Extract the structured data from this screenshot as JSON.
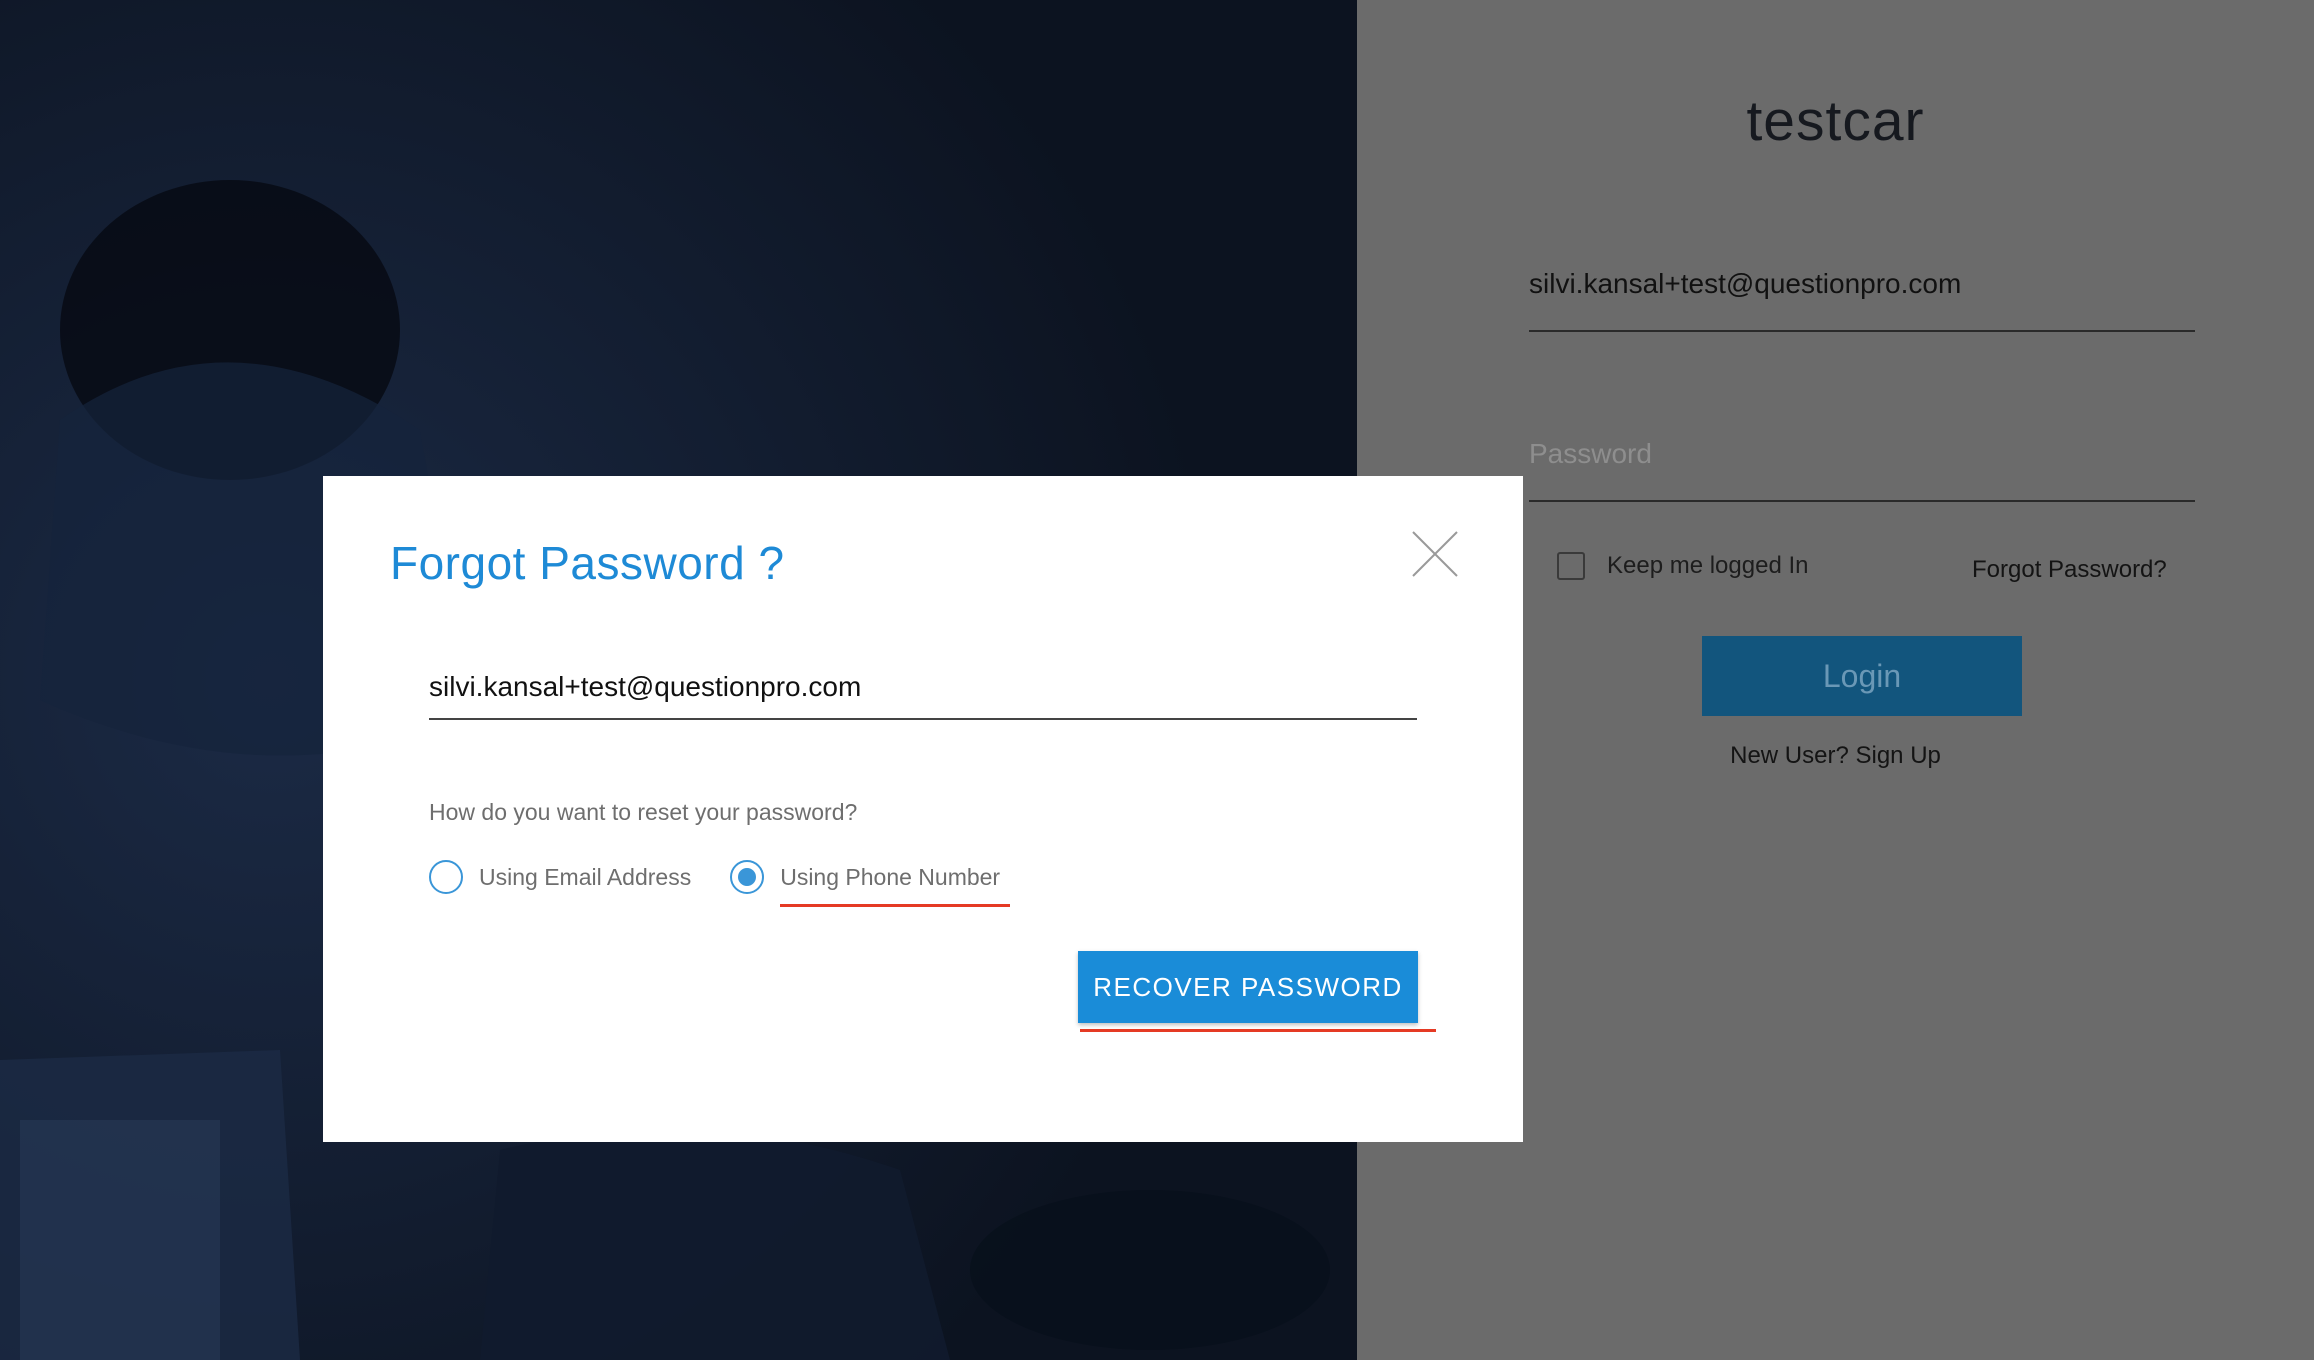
{
  "login": {
    "app_name": "testcar",
    "email_value": "silvi.kansal+test@questionpro.com",
    "password_placeholder": "Password",
    "remember_label": "Keep me logged In",
    "remember_checked": false,
    "forgot_link": "Forgot Password?",
    "login_button": "Login",
    "signup_link": "New User? Sign Up"
  },
  "modal": {
    "title": "Forgot Password ?",
    "email_value": "silvi.kansal+test@questionpro.com",
    "question": "How do you want to reset your password?",
    "options": [
      {
        "label": "Using Email Address",
        "selected": false
      },
      {
        "label": "Using Phone Number",
        "selected": true
      }
    ],
    "recover_button": "RECOVER PASSWORD",
    "close_icon": "close-icon"
  },
  "colors": {
    "hero_bg": "#0c1320",
    "panel_bg": "#6b6b6b",
    "accent_blue": "#1a8cd8",
    "title_blue": "#1e8ad6",
    "login_button_bg": "#12557d",
    "annotation_red": "#e53a24"
  }
}
